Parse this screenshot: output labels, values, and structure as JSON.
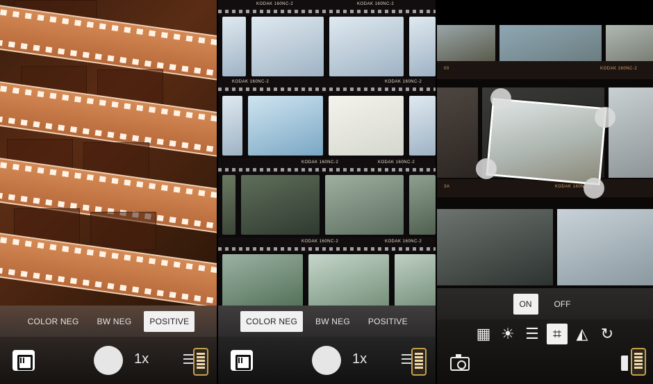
{
  "panel1": {
    "modes": [
      {
        "label": "COLOR NEG",
        "active": false
      },
      {
        "label": "BW NEG",
        "active": false
      },
      {
        "label": "POSITIVE",
        "active": true
      }
    ],
    "zoom": "1x",
    "icons": [
      "film-roll-icon",
      "shutter-button",
      "menu-icon",
      "phone-icon"
    ]
  },
  "panel2": {
    "modes": [
      {
        "label": "COLOR NEG",
        "active": true
      },
      {
        "label": "BW NEG",
        "active": false
      },
      {
        "label": "POSITIVE",
        "active": false
      }
    ],
    "zoom": "1x",
    "film_bands": [
      {
        "left": "KODAK 160NC-2",
        "right": "KODAK 160NC-2"
      },
      {
        "left": "KODAK 160NC-2",
        "right": "KODAK 160NC-2"
      },
      {
        "left": "KODAK 160NC-2",
        "right": "KODAK 160NC-2"
      },
      {
        "left": "KODAK 160NC-2",
        "right": "KODAK 160NC-2"
      }
    ]
  },
  "panel3": {
    "toggle": [
      {
        "label": "ON",
        "active": true
      },
      {
        "label": "OFF",
        "active": false
      }
    ],
    "tools": [
      {
        "icon": "film-roll-icon",
        "glyph": "▦",
        "active": false
      },
      {
        "icon": "brightness-icon",
        "glyph": "☀",
        "active": false
      },
      {
        "icon": "adjust-sliders-icon",
        "glyph": "☰",
        "active": false
      },
      {
        "icon": "crop-icon",
        "glyph": "⌗",
        "active": true
      },
      {
        "icon": "flip-icon",
        "glyph": "◭",
        "active": false
      },
      {
        "icon": "rotate-icon",
        "glyph": "↻",
        "active": false
      }
    ],
    "film_bands": [
      {
        "left": "00",
        "right": "KODAK 160NC-2"
      },
      {
        "left": "3A",
        "right": "KODAK 160NC-2"
      }
    ]
  }
}
